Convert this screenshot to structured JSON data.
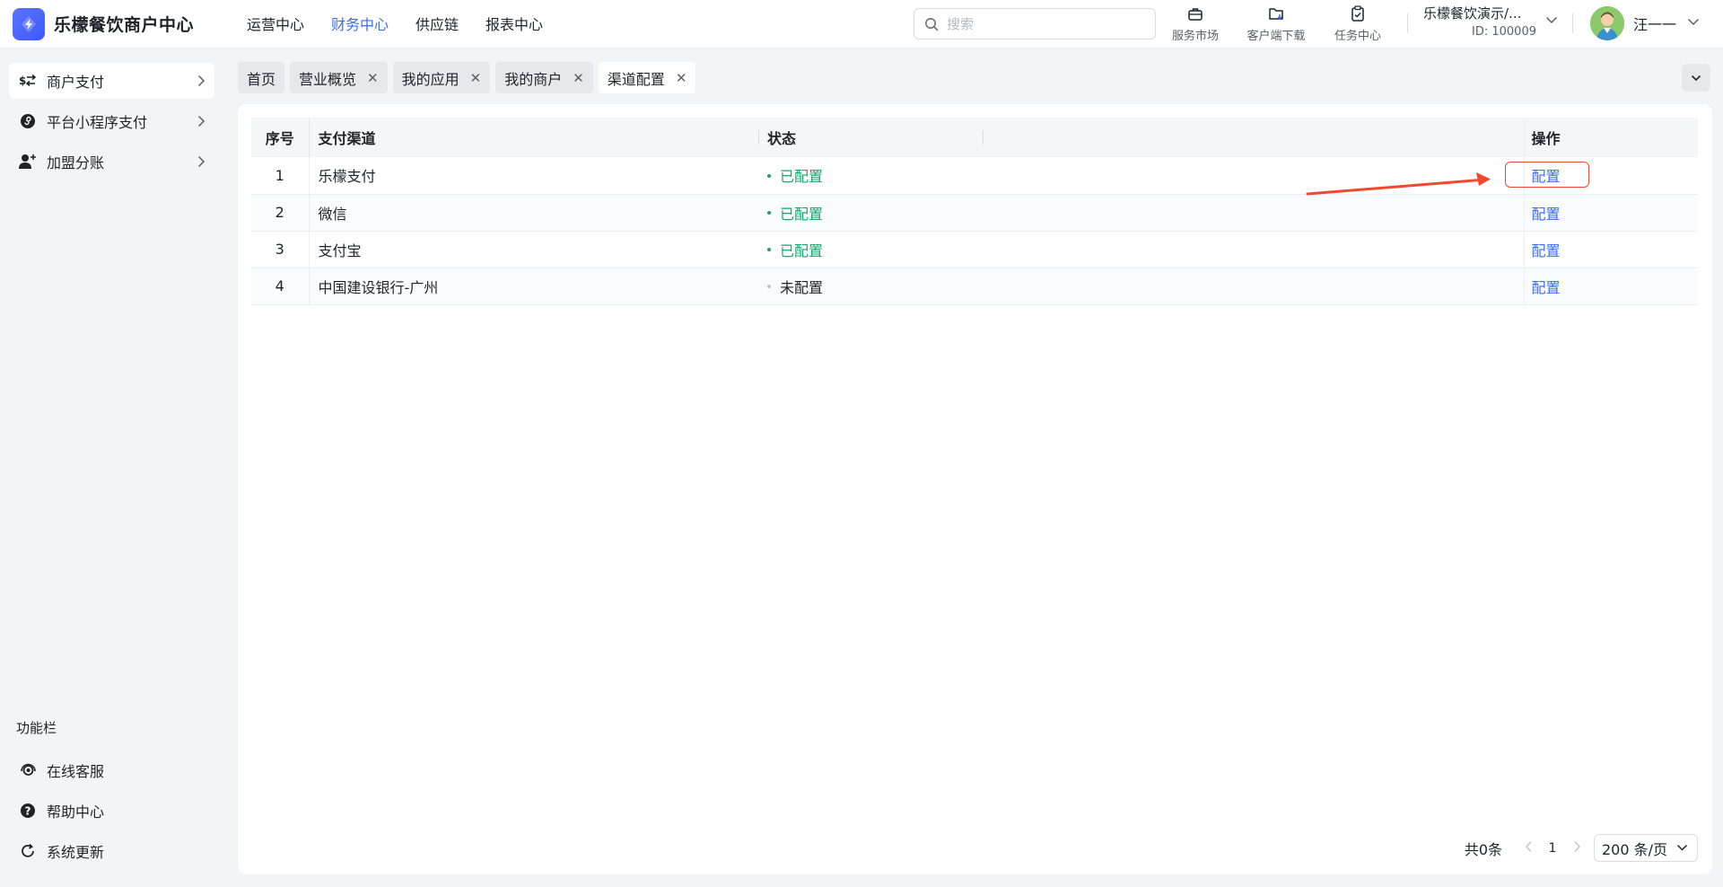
{
  "app": {
    "title": "乐檬餐饮商户中心"
  },
  "nav": {
    "items": [
      {
        "label": "运营中心",
        "active": false
      },
      {
        "label": "财务中心",
        "active": true
      },
      {
        "label": "供应链",
        "active": false
      },
      {
        "label": "报表中心",
        "active": false
      }
    ]
  },
  "search": {
    "placeholder": "搜索",
    "value": ""
  },
  "tools": [
    {
      "label": "服务市场",
      "icon": "briefcase-icon"
    },
    {
      "label": "客户端下载",
      "icon": "folder-download-icon"
    },
    {
      "label": "任务中心",
      "icon": "clipboard-check-icon"
    }
  ],
  "merchant": {
    "name": "乐檬餐饮演示/...",
    "id": "ID: 100009"
  },
  "user": {
    "name": "汪一一"
  },
  "sidebar": {
    "items": [
      {
        "label": "商户支付",
        "icon": "payment-exchange-icon",
        "active": true
      },
      {
        "label": "平台小程序支付",
        "icon": "mini-program-icon",
        "active": false
      },
      {
        "label": "加盟分账",
        "icon": "add-user-icon",
        "active": false
      }
    ],
    "section_title": "功能栏",
    "bottom_items": [
      {
        "label": "在线客服",
        "icon": "headset-icon"
      },
      {
        "label": "帮助中心",
        "icon": "help-circle-icon"
      },
      {
        "label": "系统更新",
        "icon": "refresh-icon"
      }
    ]
  },
  "tabs": [
    {
      "label": "首页",
      "closable": false,
      "active": false
    },
    {
      "label": "营业概览",
      "closable": true,
      "active": false
    },
    {
      "label": "我的应用",
      "closable": true,
      "active": false
    },
    {
      "label": "我的商户",
      "closable": true,
      "active": false
    },
    {
      "label": "渠道配置",
      "closable": true,
      "active": true
    }
  ],
  "table": {
    "headers": {
      "index": "序号",
      "channel": "支付渠道",
      "status": "状态",
      "action": "操作"
    },
    "rows": [
      {
        "index": "1",
        "channel": "乐檬支付",
        "status": "已配置",
        "configured": true,
        "action": "配置"
      },
      {
        "index": "2",
        "channel": "微信",
        "status": "已配置",
        "configured": true,
        "action": "配置"
      },
      {
        "index": "3",
        "channel": "支付宝",
        "status": "已配置",
        "configured": true,
        "action": "配置"
      },
      {
        "index": "4",
        "channel": "中国建设银行-广州",
        "status": "未配置",
        "configured": false,
        "action": "配置"
      }
    ]
  },
  "pagination": {
    "total_text": "共0条",
    "current_page": "1",
    "page_size": "200 条/页"
  },
  "colors": {
    "accent": "#3b6cf6",
    "status_ok": "#1aa36b",
    "annotation": "#ef4a2f"
  }
}
